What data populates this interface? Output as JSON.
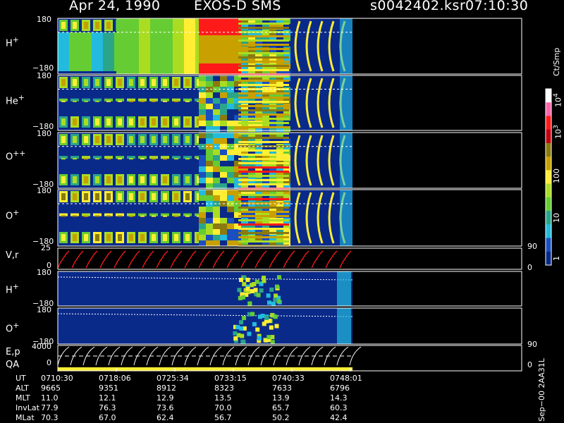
{
  "header": {
    "date": "Apr 24, 1990",
    "title": "EXOS-D SMS",
    "file": "s0042402.ksr",
    "time": "07:10:30"
  },
  "panels": [
    {
      "label": "H",
      "sup": "+",
      "top": "180",
      "bottom": "−180"
    },
    {
      "label": "He",
      "sup": "+",
      "top": "180",
      "bottom": "−180"
    },
    {
      "label": "O",
      "sup": "++",
      "top": "180",
      "bottom": "−180"
    },
    {
      "label": "O",
      "sup": "+",
      "top": "180",
      "bottom": "−180"
    },
    {
      "label": "V,r",
      "sup": "",
      "top": "25",
      "bottom": "0",
      "right_top": "90",
      "right_bottom": "0"
    },
    {
      "label": "H",
      "sup": "+",
      "top": "180",
      "bottom": "−180"
    },
    {
      "label": "O",
      "sup": "+",
      "top": "180",
      "bottom": "−180"
    },
    {
      "label": "E,p",
      "sup": "",
      "top": "4000",
      "bottom": "0",
      "right_top": "90",
      "right_bottom": "0"
    }
  ],
  "qa_label": "QA",
  "colorbar": {
    "unit": "Ct/Smp",
    "ticks": [
      {
        "base": "10",
        "exp": "4"
      },
      {
        "base": "10",
        "exp": "3"
      },
      {
        "base": "100",
        "exp": ""
      },
      {
        "base": "10",
        "exp": ""
      },
      {
        "base": "1",
        "exp": ""
      }
    ]
  },
  "footer_code": "Sep−00 2AA31L",
  "ephemeris": {
    "rows": [
      {
        "name": "UT",
        "values": [
          "0710:30",
          "0718:06",
          "0725:34",
          "0733:15",
          "0740:33",
          "0748:01"
        ]
      },
      {
        "name": "ALT",
        "values": [
          "9665",
          "9351",
          "8912",
          "8323",
          "7633",
          "6796"
        ]
      },
      {
        "name": "MLT",
        "values": [
          "11.0",
          "12.1",
          "12.9",
          "13.5",
          "13.9",
          "14.3"
        ]
      },
      {
        "name": "InvLat",
        "values": [
          "77.9",
          "76.3",
          "73.6",
          "70.0",
          "65.7",
          "60.3"
        ]
      },
      {
        "name": "MLat",
        "values": [
          "70.3",
          "67.0",
          "62.4",
          "56.7",
          "50.2",
          "42.4"
        ]
      }
    ]
  },
  "chart_data": {
    "type": "heatmap",
    "title": "EXOS-D SMS",
    "time_ticks": [
      "0710:30",
      "0718:06",
      "0725:34",
      "0733:15",
      "0740:33",
      "0748:01"
    ],
    "panels": [
      "H+",
      "He+",
      "O++",
      "O+",
      "V,r",
      "H+",
      "O+",
      "E,p"
    ],
    "pitch_angle_range": [
      -180,
      180
    ],
    "colorbar_range": [
      1,
      10000
    ],
    "colorbar_scale": "log",
    "colorbar_unit": "Ct/Smp"
  },
  "colors": {
    "background": "#000000",
    "panel_fill": "#0a2a8a",
    "red": "#ff1a1a",
    "yellow": "#ffee33",
    "green": "#66cc33",
    "cyan": "#22bbdd",
    "white": "#ffffff"
  }
}
